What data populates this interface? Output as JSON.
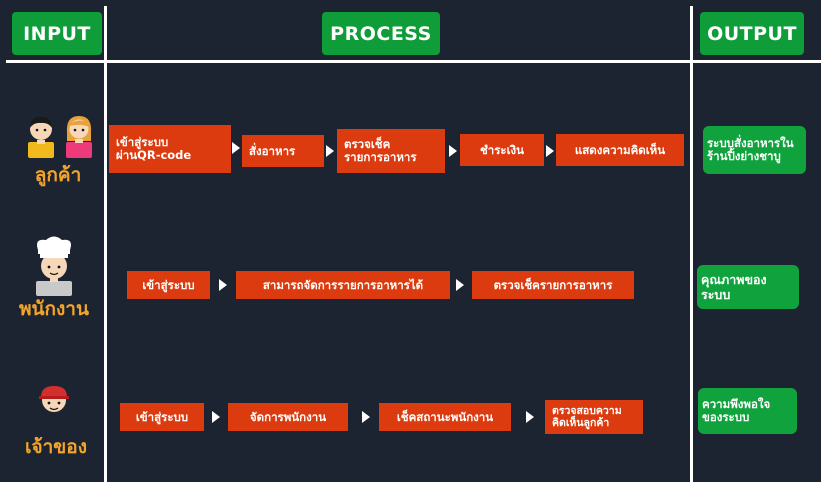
{
  "headers": {
    "input": "INPUT",
    "process": "PROCESS",
    "output": "OUTPUT"
  },
  "rows": [
    {
      "role": "ลูกค้า",
      "steps": [
        "เข้าสู่ระบบ\nผ่านQR-code",
        "สั่งอาหาร",
        "ตรวจเช็ค\nรายการอาหาร",
        "ชำระเงิน",
        "แสดงความคิดเห็น"
      ],
      "output": "ระบบสั่งอาหารใน\nร้านปิ้งย่างชาบู"
    },
    {
      "role": "พนักงาน",
      "steps": [
        "เข้าสู่ระบบ",
        "สามารถจัดการรายการอาหารได้",
        "ตรวจเช็ครายการอาหาร"
      ],
      "output": "คุณภาพของ\nระบบ"
    },
    {
      "role": "เจ้าของ",
      "steps": [
        "เข้าสู่ระบบ",
        "จัดการพนักงาน",
        "เช็คสถานะพนักงาน",
        "ตรวจสอบความ\nคิดเห็นลูกค้า"
      ],
      "output": "ความพึงพอใจ\nของระบบ"
    }
  ],
  "icons": [
    "customer-male-avatar-icon",
    "customer-female-avatar-icon",
    "chef-avatar-icon",
    "owner-avatar-icon"
  ],
  "colors": {
    "background": "#1d2431",
    "header": "#0f9d3a",
    "step": "#dc3b0f",
    "output": "#10a33d",
    "role_text": "#f3a42a"
  }
}
